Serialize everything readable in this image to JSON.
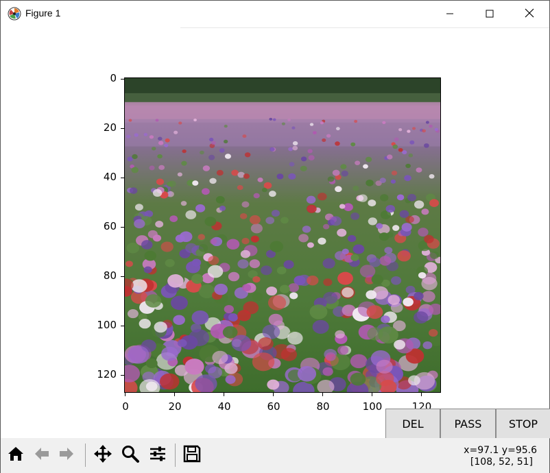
{
  "window": {
    "title": "Figure 1",
    "icons": {
      "app": "matplotlib-logo-icon",
      "minimize": "minimize-icon",
      "maximize": "maximize-icon",
      "close": "close-icon"
    }
  },
  "plot": {
    "image_subject": "field of anemone flowers",
    "y_ticks": [
      "0",
      "20",
      "40",
      "60",
      "80",
      "100",
      "120"
    ],
    "x_ticks": [
      "0",
      "20",
      "40",
      "60",
      "80",
      "100",
      "120"
    ]
  },
  "buttons": {
    "del_label": "DEL",
    "pass_label": "PASS",
    "stop_label": "STOP"
  },
  "toolbar": {
    "icons": [
      "home-icon",
      "back-arrow-icon",
      "forward-arrow-icon",
      "pan-icon",
      "zoom-icon",
      "configure-subplots-icon",
      "save-icon"
    ],
    "coords_line1": "x=97.1 y=95.6",
    "coords_line2": "[108, 52, 51]"
  }
}
